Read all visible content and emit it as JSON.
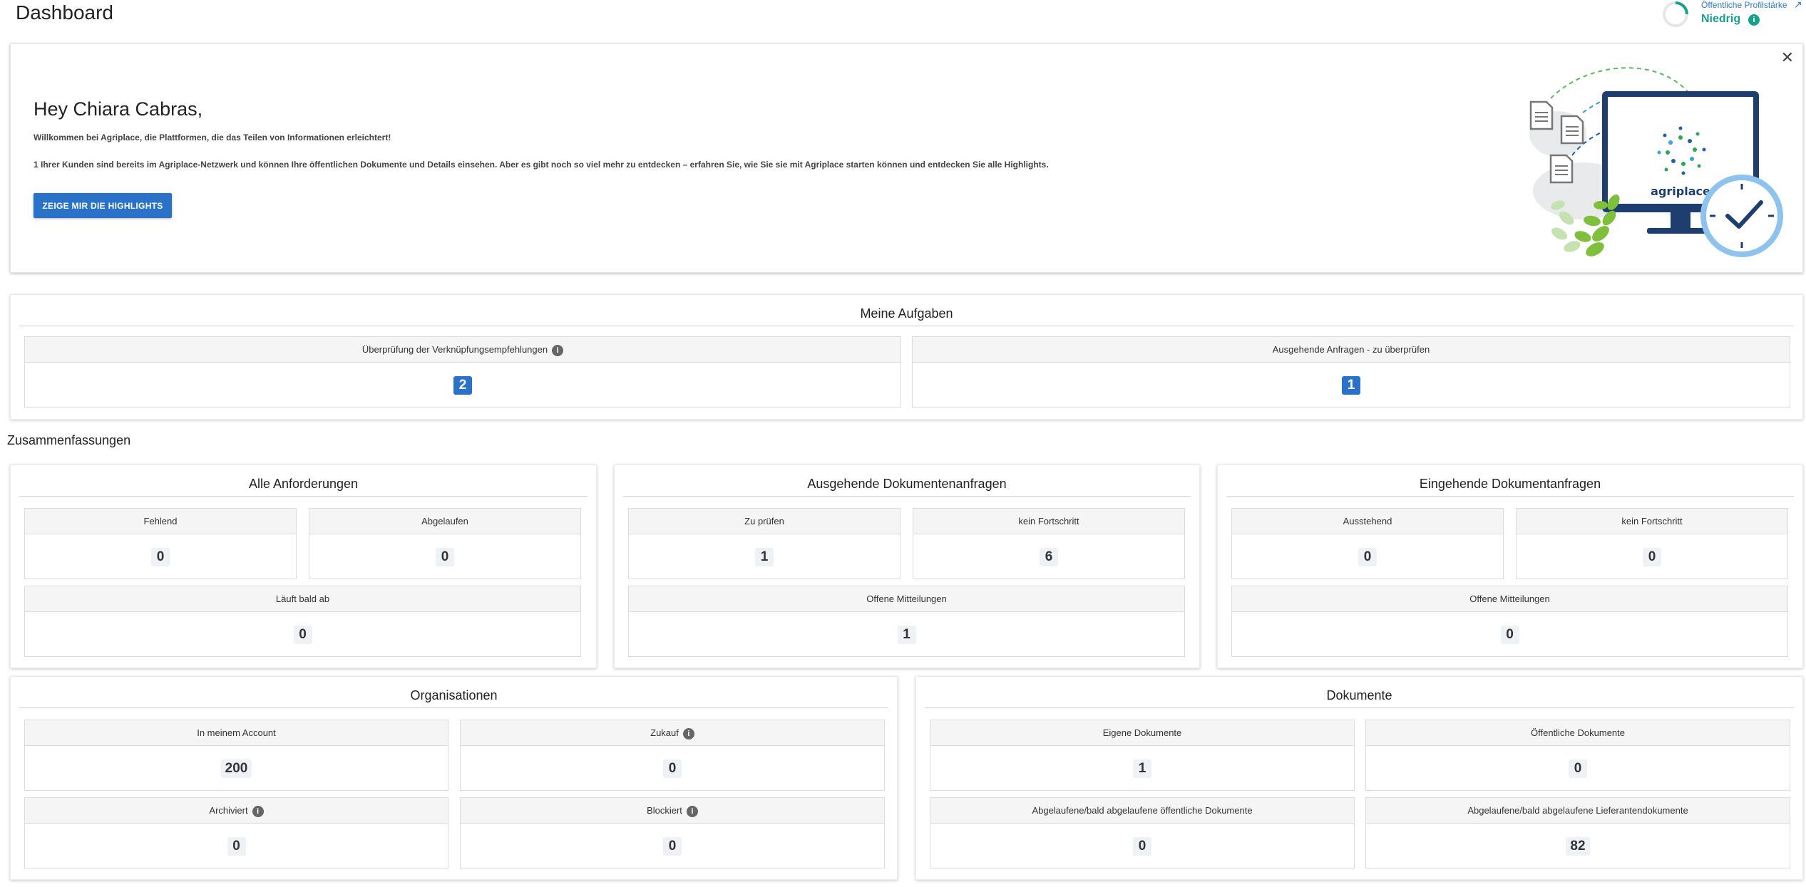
{
  "header": {
    "title": "Dashboard",
    "profile_strength_label": "Öffentliche Profilstärke",
    "profile_strength_value": "Niedrig"
  },
  "welcome": {
    "greeting": "Hey Chiara Cabras,",
    "line1": "Willkommen bei Agriplace, die Plattformen, die das Teilen von Informationen erleichtert!",
    "line2": "1 Ihrer Kunden sind bereits im Agriplace-Netzwerk und können Ihre öffentlichen Dokumente und Details einsehen. Aber es gibt noch so viel mehr zu entdecken – erfahren Sie, wie Sie sie mit Agriplace starten können und entdecken Sie alle Highlights.",
    "button": "ZEIGE MIR DIE HIGHLIGHTS",
    "logo_text": "agriplace"
  },
  "tasks": {
    "title": "Meine Aufgaben",
    "items": [
      {
        "label": "Überprüfung der Verknüpfungsempfehlungen",
        "value": "2"
      },
      {
        "label": "Ausgehende Anfragen - zu überprüfen",
        "value": "1"
      }
    ]
  },
  "summaries": {
    "heading": "Zusammenfassungen",
    "requirements": {
      "title": "Alle Anforderungen",
      "items": [
        {
          "label": "Fehlend",
          "value": "0"
        },
        {
          "label": "Abgelaufen",
          "value": "0"
        },
        {
          "label": "Läuft bald ab",
          "value": "0"
        }
      ]
    },
    "outgoing": {
      "title": "Ausgehende Dokumentenanfragen",
      "items": [
        {
          "label": "Zu prüfen",
          "value": "1"
        },
        {
          "label": "kein Fortschritt",
          "value": "6"
        },
        {
          "label": "Offene Mitteilungen",
          "value": "1"
        }
      ]
    },
    "incoming": {
      "title": "Eingehende Dokumentanfragen",
      "items": [
        {
          "label": "Ausstehend",
          "value": "0"
        },
        {
          "label": "kein Fortschritt",
          "value": "0"
        },
        {
          "label": "Offene Mitteilungen",
          "value": "0"
        }
      ]
    },
    "organisations": {
      "title": "Organisationen",
      "items": [
        {
          "label": "In meinem Account",
          "value": "200"
        },
        {
          "label": "Zukauf",
          "value": "0"
        },
        {
          "label": "Archiviert",
          "value": "0"
        },
        {
          "label": "Blockiert",
          "value": "0"
        }
      ]
    },
    "documents": {
      "title": "Dokumente",
      "items": [
        {
          "label": "Eigene Dokumente",
          "value": "1"
        },
        {
          "label": "Öffentliche Dokumente",
          "value": "0"
        },
        {
          "label": "Abgelaufene/bald abgelaufene öffentliche Dokumente",
          "value": "0"
        },
        {
          "label": "Abgelaufene/bald abgelaufene Lieferantendokumente",
          "value": "82"
        }
      ]
    }
  },
  "colors": {
    "primary": "#2a72c9",
    "accent_green": "#18a08a",
    "badge_bg": "#eef1f5"
  }
}
